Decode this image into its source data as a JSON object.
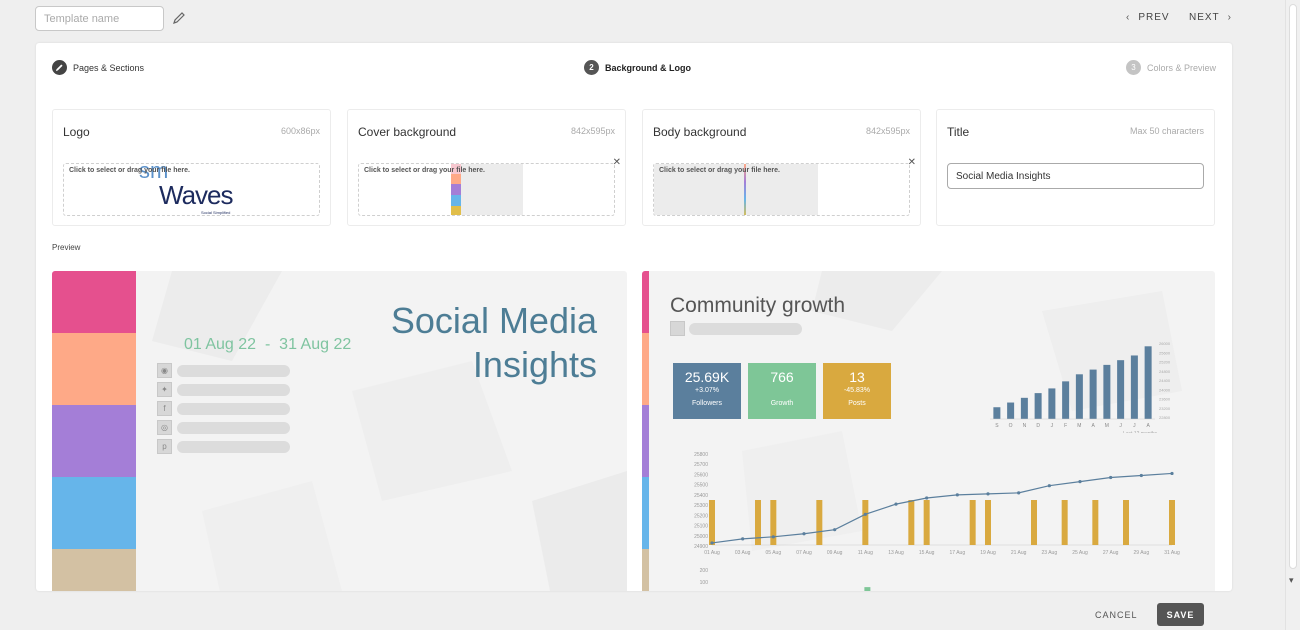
{
  "topbar": {
    "template_name_placeholder": "Template name",
    "template_name_value": "",
    "prev_label": "PREV",
    "next_label": "NEXT"
  },
  "steps": [
    {
      "num": "",
      "icon": "pencil-icon",
      "label": "Pages & Sections",
      "state": "done"
    },
    {
      "num": "2",
      "label": "Background & Logo",
      "state": "active"
    },
    {
      "num": "3",
      "label": "Colors & Preview",
      "state": "upcoming"
    }
  ],
  "panels": {
    "logo": {
      "title": "Logo",
      "hint": "600x86px",
      "dropzone": "Click to select or drag your file here.",
      "logo_text_top": "sm",
      "logo_text": "Waves",
      "logo_small": "Social Simplified"
    },
    "cover": {
      "title": "Cover background",
      "hint": "842x595px",
      "dropzone": "Click to select or drag your file here."
    },
    "body": {
      "title": "Body background",
      "hint": "842x595px",
      "dropzone": "Click to select or drag your file here."
    },
    "title": {
      "title": "Title",
      "hint": "Max 50 characters",
      "value": "Social Media Insights"
    }
  },
  "preview": {
    "label": "Preview",
    "cover": {
      "title_line1": "Social Media",
      "title_line2": "Insights",
      "date_range": "01 Aug 22  -  31 Aug 22",
      "stripe_colors": [
        "#e5508e",
        "#fea987",
        "#a47ed7",
        "#66b5ea",
        "#d3c1a3"
      ],
      "social_icons": [
        "rss-icon",
        "twitter-icon",
        "facebook-icon",
        "instagram-icon",
        "pinterest-icon"
      ]
    },
    "body": {
      "title": "Community growth",
      "kpis": [
        {
          "value": "25.69K",
          "delta": "+3.07%",
          "label": "Followers",
          "color": "#5b7f9d"
        },
        {
          "value": "766",
          "delta": "",
          "label": "Growth",
          "color": "#7ec697"
        },
        {
          "value": "13",
          "delta": "-45.83%",
          "label": "Posts",
          "color": "#d9a93f"
        }
      ]
    }
  },
  "chart_data": [
    {
      "type": "bar",
      "categories": [
        "S",
        "O",
        "N",
        "D",
        "J",
        "F",
        "M",
        "A",
        "M",
        "J",
        "J",
        "A"
      ],
      "values": [
        23100,
        23300,
        23500,
        23700,
        23900,
        24200,
        24500,
        24700,
        24900,
        25100,
        25300,
        25690
      ],
      "ylim": [
        22600,
        26000
      ],
      "yticks": [
        "26000",
        "25600",
        "25200",
        "24800",
        "24400",
        "24000",
        "23600",
        "23200",
        "22800"
      ],
      "xlabel": "Last 12 months",
      "color": "#5b7f9d"
    },
    {
      "type": "line",
      "x": [
        "01 Aug",
        "03 Aug",
        "05 Aug",
        "07 Aug",
        "09 Aug",
        "11 Aug",
        "13 Aug",
        "15 Aug",
        "17 Aug",
        "19 Aug",
        "21 Aug",
        "23 Aug",
        "25 Aug",
        "27 Aug",
        "29 Aug",
        "31 Aug"
      ],
      "line_values": [
        24920,
        24960,
        24980,
        25010,
        25050,
        25200,
        25300,
        25360,
        25390,
        25400,
        25410,
        25480,
        25520,
        25560,
        25580,
        25600
      ],
      "bar_days": [
        1,
        4,
        5,
        8,
        11,
        14,
        15,
        18,
        19,
        22,
        24,
        26,
        28,
        31
      ],
      "ylim": [
        24900,
        25800
      ],
      "yticks": [
        "25800",
        "25700",
        "25600",
        "25500",
        "25400",
        "25300",
        "25200",
        "25100",
        "25000",
        "24900"
      ],
      "line_color": "#5b7f9d",
      "bar_color": "#d9a93f"
    },
    {
      "type": "bar",
      "yticks": [
        "200",
        "100"
      ],
      "values": [
        0,
        10,
        20,
        10,
        0,
        0,
        10,
        0,
        10,
        10,
        60,
        10,
        10,
        20,
        10,
        0,
        0,
        0,
        10,
        0,
        0,
        20,
        10,
        0,
        0,
        10,
        0,
        0,
        10,
        0,
        0
      ],
      "color": "#7ec697"
    }
  ],
  "footer": {
    "cancel_label": "CANCEL",
    "save_label": "SAVE"
  }
}
